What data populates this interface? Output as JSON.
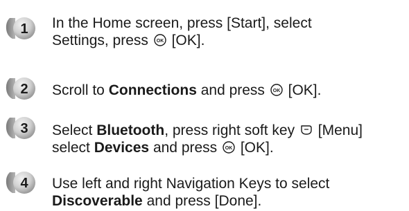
{
  "steps": [
    {
      "number": "1",
      "line1": "In the Home screen, press [Start], select",
      "line2_a": "Settings, press ",
      "line2_b": " [OK]."
    },
    {
      "number": "2",
      "line1_a": "Scroll to ",
      "line1_bold": "Connections",
      "line1_b": " and press ",
      "line1_c": " [OK]."
    },
    {
      "number": "3",
      "line1_a": "Select ",
      "line1_bold": "Bluetooth",
      "line1_b": ", press right soft key ",
      "line1_c": " [Menu]",
      "line2_a": "select ",
      "line2_bold": "Devices",
      "line2_b": " and press ",
      "line2_c": " [OK]."
    },
    {
      "number": "4",
      "line1": "Use left and right Navigation Keys to select",
      "line2_bold": "Discoverable",
      "line2_b": " and press [Done]."
    }
  ],
  "icons": {
    "ok_key": "ok-key-icon",
    "soft_key": "right-soft-key-icon"
  },
  "colors": {
    "badge_dark": "#8c8c8c",
    "badge_light": "#e6e6e6",
    "text": "#1a1a1a"
  }
}
